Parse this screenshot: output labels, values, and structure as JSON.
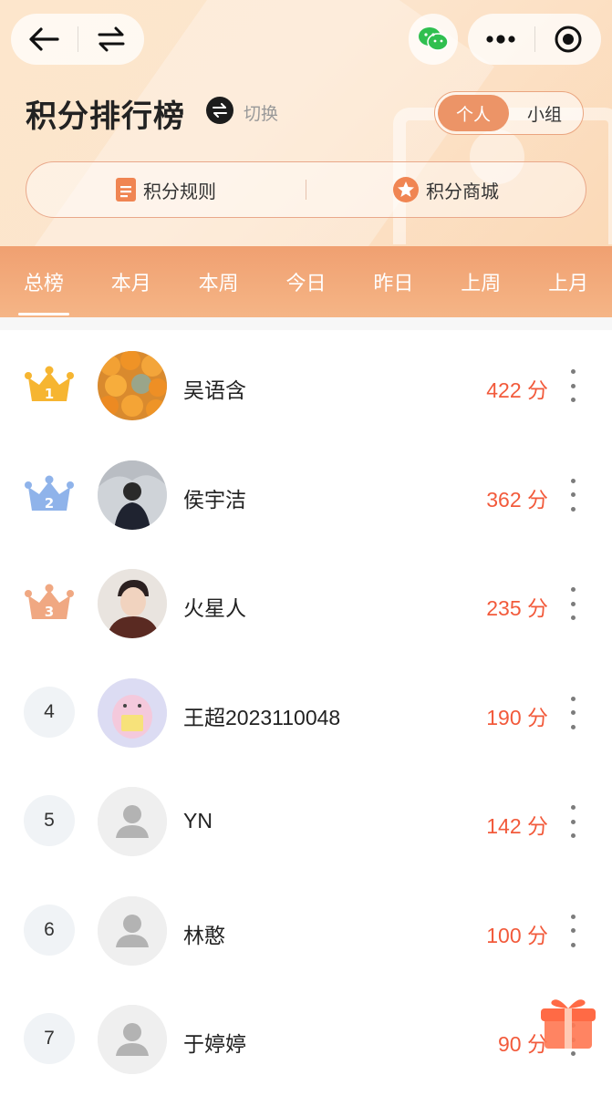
{
  "header": {
    "title": "积分排行榜",
    "switch_label": "切换",
    "segment": {
      "options": [
        "个人",
        "小组"
      ],
      "selected": "个人"
    },
    "links": {
      "rules": "积分规则",
      "mall": "积分商城"
    }
  },
  "tabs": [
    {
      "label": "总榜",
      "active": true
    },
    {
      "label": "本月",
      "active": false
    },
    {
      "label": "本周",
      "active": false
    },
    {
      "label": "今日",
      "active": false
    },
    {
      "label": "昨日",
      "active": false
    },
    {
      "label": "上周",
      "active": false
    },
    {
      "label": "上月",
      "active": false
    }
  ],
  "ranking": [
    {
      "rank": "1",
      "name": "吴语含",
      "score": "422 分",
      "avatar": "oranges-photo"
    },
    {
      "rank": "2",
      "name": "侯宇洁",
      "score": "362 分",
      "avatar": "person-photo"
    },
    {
      "rank": "3",
      "name": "火星人",
      "score": "235 分",
      "avatar": "child-photo"
    },
    {
      "rank": "4",
      "name": "王超2023110048",
      "score": "190 分",
      "avatar": "cartoon-photo"
    },
    {
      "rank": "5",
      "name": "YN",
      "score": "142 分",
      "avatar": "default-user-icon"
    },
    {
      "rank": "6",
      "name": "林憨",
      "score": "100 分",
      "avatar": "default-user-icon"
    },
    {
      "rank": "7",
      "name": "于婷婷",
      "score": "90 分",
      "avatar": "default-user-icon"
    }
  ],
  "colors": {
    "accent": "#ec9467",
    "score": "#f25a3b",
    "gold": "#f6b531",
    "silver": "#8fb3ea",
    "bronze": "#f0a882"
  },
  "icons": {
    "back": "arrow-left-icon",
    "switch_nav": "swap-icon",
    "wechat": "wechat-icon",
    "menu": "more-dots-icon",
    "target": "record-icon",
    "gift": "gift-icon"
  }
}
